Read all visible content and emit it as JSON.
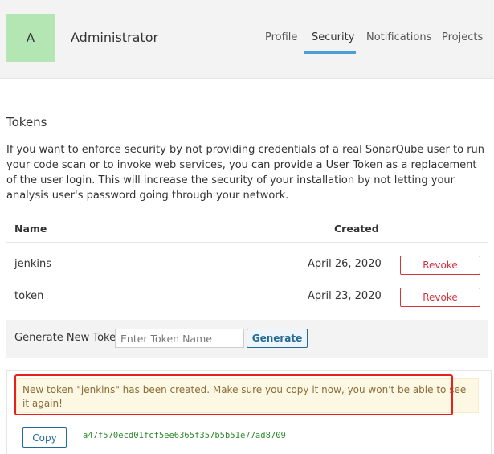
{
  "header": {
    "avatar_letter": "A",
    "avatar_color": "#b3e6b3",
    "user_name": "Administrator",
    "tabs": [
      {
        "label": "Profile"
      },
      {
        "label": "Security",
        "active": true
      },
      {
        "label": "Notifications"
      },
      {
        "label": "Projects"
      }
    ],
    "accent_color": "#4b9fd5"
  },
  "tokens": {
    "title": "Tokens",
    "description": "If you want to enforce security by not providing credentials of a real SonarQube user to run your code scan or to invoke web services, you can provide a User Token as a replacement of the user login. This will increase the security of your installation by not letting your analysis user's password going through your network.",
    "columns": {
      "name": "Name",
      "created": "Created"
    },
    "rows": [
      {
        "name": "jenkins",
        "created": "April 26, 2020",
        "action": "Revoke"
      },
      {
        "name": "token",
        "created": "April 23, 2020",
        "action": "Revoke"
      }
    ]
  },
  "generate": {
    "label": "Generate New Token:",
    "placeholder": "Enter Token Name",
    "value": "",
    "button": "Generate"
  },
  "result": {
    "message": "New token \"jenkins\" has been created. Make sure you copy it now, you won't be able to see it again!",
    "copy_button": "Copy",
    "token": "a47f570ecd01fcf5ee6365f357b5b51e77ad8709",
    "token_color": "#2e8b2e",
    "highlight_color": "#e8201c"
  }
}
